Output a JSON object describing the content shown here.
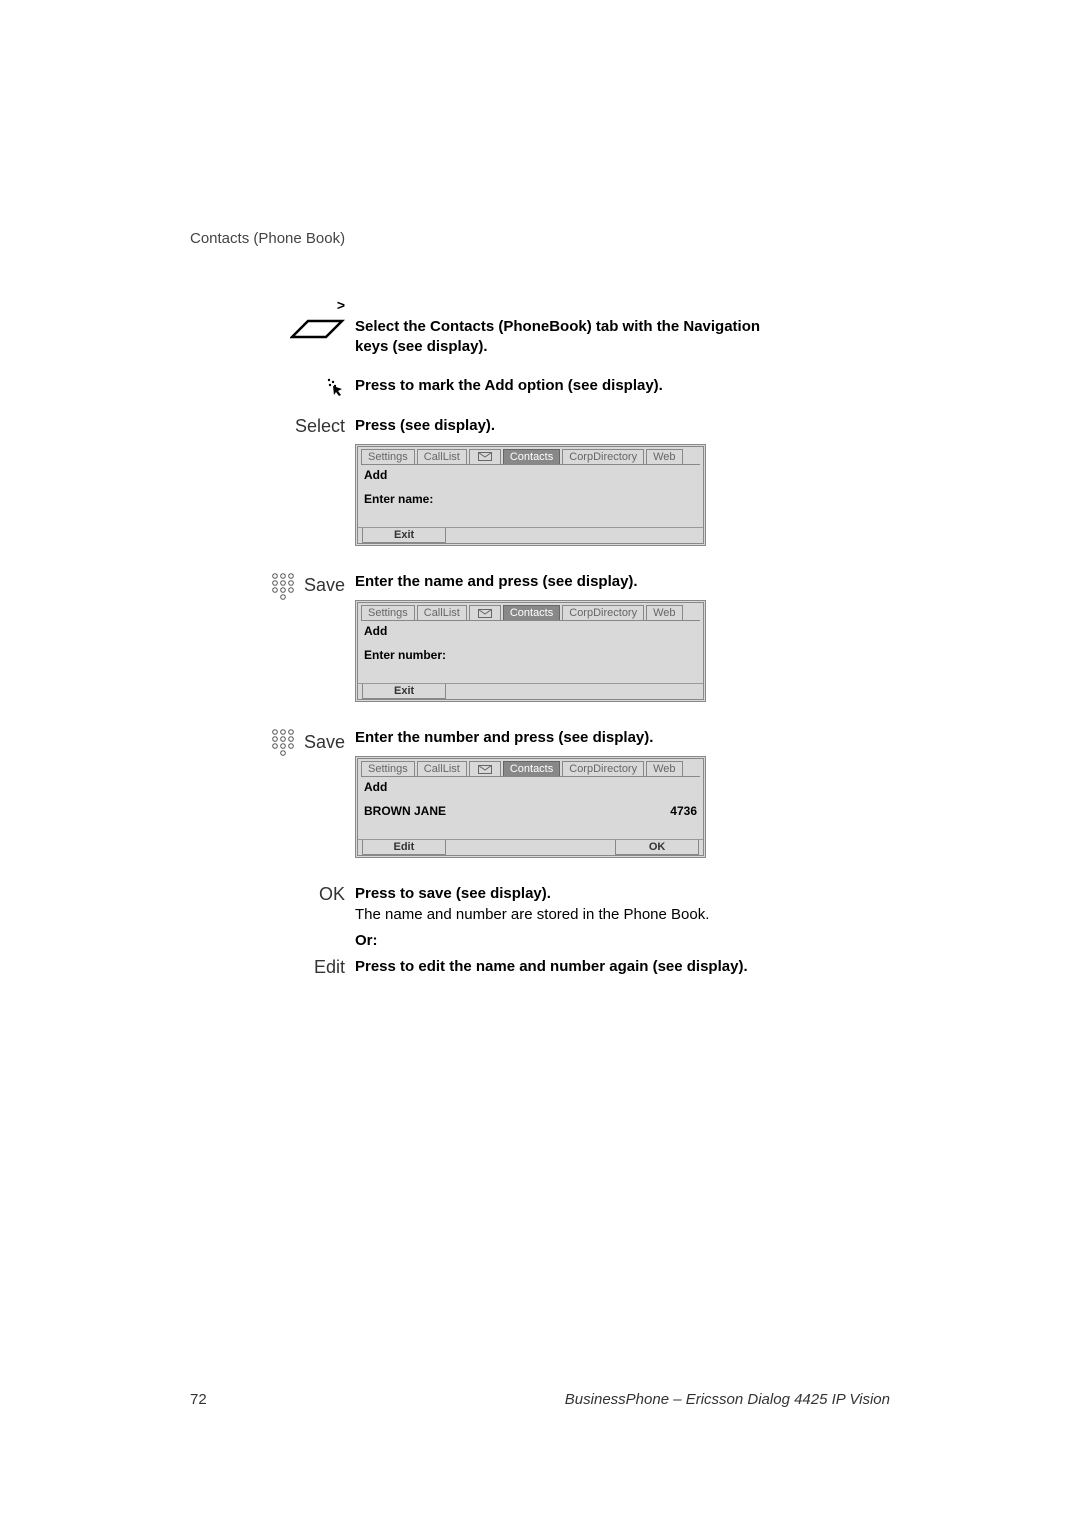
{
  "header": {
    "section": "Contacts (Phone Book)"
  },
  "steps": {
    "nav_arrow": ">",
    "step1": "Select the Contacts (PhoneBook) tab with the Navigation keys (see display).",
    "step2": "Press to mark the Add option (see display).",
    "select_label": "Select",
    "step3": "Press (see display).",
    "save_label": "Save",
    "step4": "Enter the name and press (see display).",
    "step5": "Enter the number and press (see display).",
    "ok_label": "OK",
    "step6a": "Press to save (see display).",
    "step6b": "The name and number are stored in the Phone Book.",
    "or_label": "Or:",
    "edit_label": "Edit",
    "step7": "Press to edit the name and number again (see display)."
  },
  "display_tabs": {
    "settings": "Settings",
    "calllist": "CallList",
    "contacts": "Contacts",
    "corpdir": "CorpDirectory",
    "web": "Web"
  },
  "display1": {
    "title": "Add",
    "prompt": "Enter name:",
    "soft_left": "Exit"
  },
  "display2": {
    "title": "Add",
    "prompt": "Enter number:",
    "soft_left": "Exit"
  },
  "display3": {
    "title": "Add",
    "entry_name": "BROWN JANE",
    "entry_number": "4736",
    "soft_left": "Edit",
    "soft_right": "OK"
  },
  "footer": {
    "page": "72",
    "product": "BusinessPhone – Ericsson Dialog 4425 IP Vision"
  }
}
